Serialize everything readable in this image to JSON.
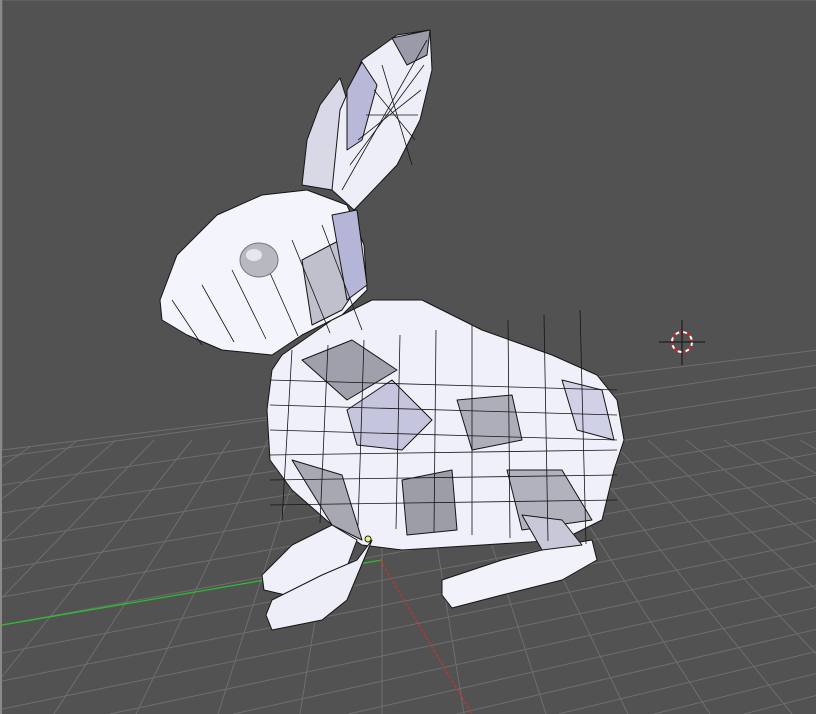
{
  "viewport": {
    "view": "3D Viewport",
    "background_color": "#525252",
    "grid_color": "#6e6e6e",
    "x_axis_color": "#2bbf2b",
    "y_axis_color": "#c83232",
    "mesh_fill_color": "#f2f2fa",
    "mesh_edge_color": "#111111",
    "object": "bunny-mesh",
    "mode": "edit"
  }
}
